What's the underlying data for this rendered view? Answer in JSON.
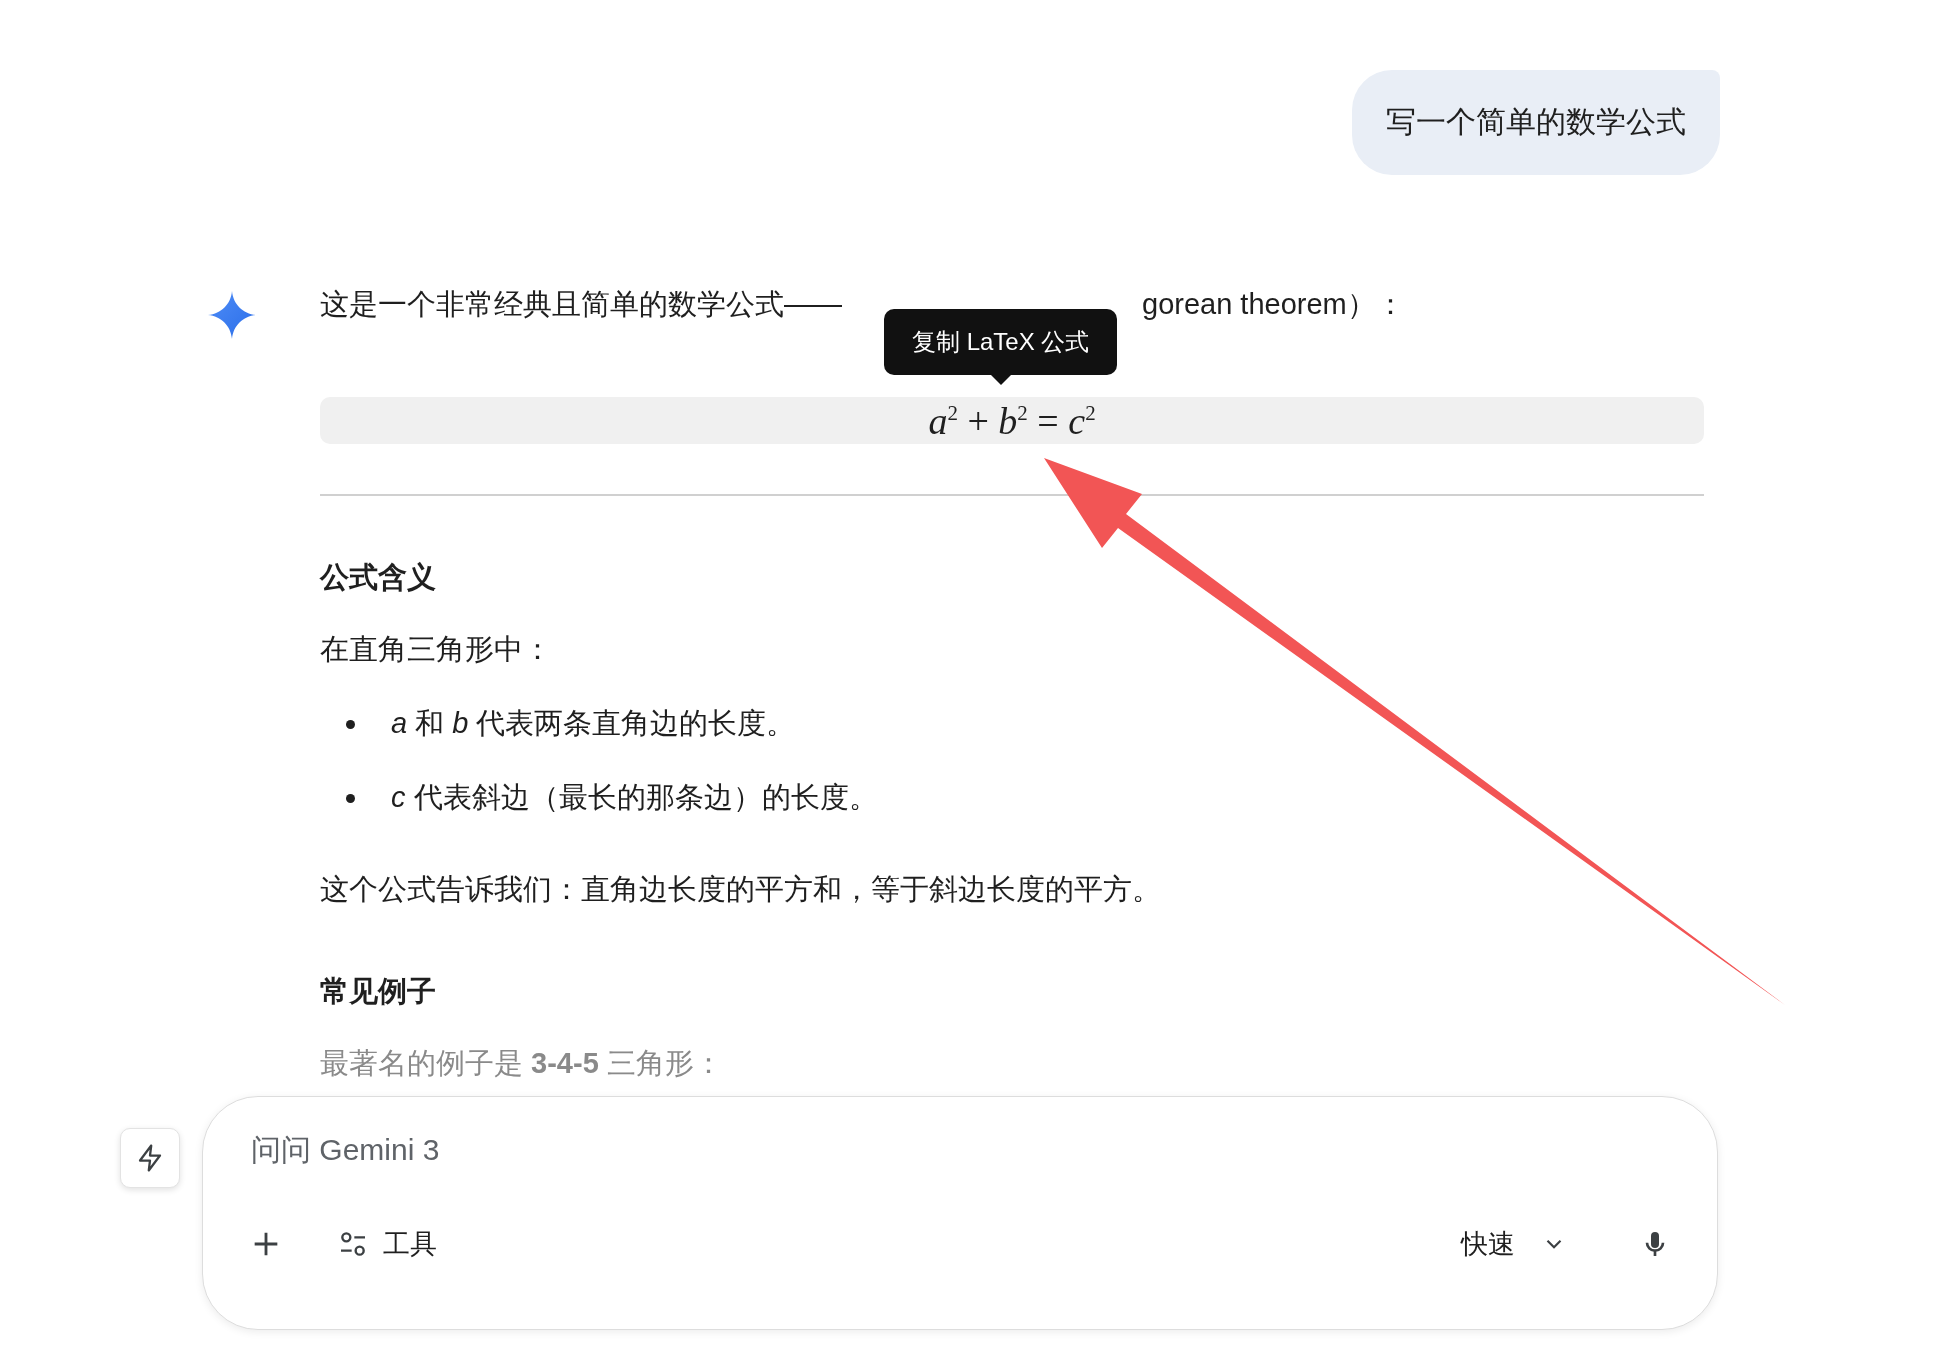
{
  "user_message": "写一个简单的数学公式",
  "response": {
    "intro_start": "这是一个非常经典且简单的数学公式——",
    "intro_end": "gorean theorem）：",
    "tooltip": "复制 LaTeX 公式",
    "formula": "*a*$^{2}$ + *b*$^{2}$ = *c*$^{2}$",
    "sections": [
      {
        "heading": "公式含义",
        "lead": "在直角三角形中：",
        "bullets": [
          "*a* 和 *b* 代表两条直角边的长度。",
          "*c* 代表斜边（最长的那条边）的长度。"
        ],
        "summary": "这个公式告诉我们：直角边长度的平方和，等于斜边长度的平方。"
      },
      {
        "heading": "常见例子",
        "lead": "最著名的例子是 **3-4-5** 三角形："
      }
    ]
  },
  "input": {
    "placeholder": "问问 Gemini 3",
    "tools_label": "工具",
    "mode_label": "快速"
  }
}
